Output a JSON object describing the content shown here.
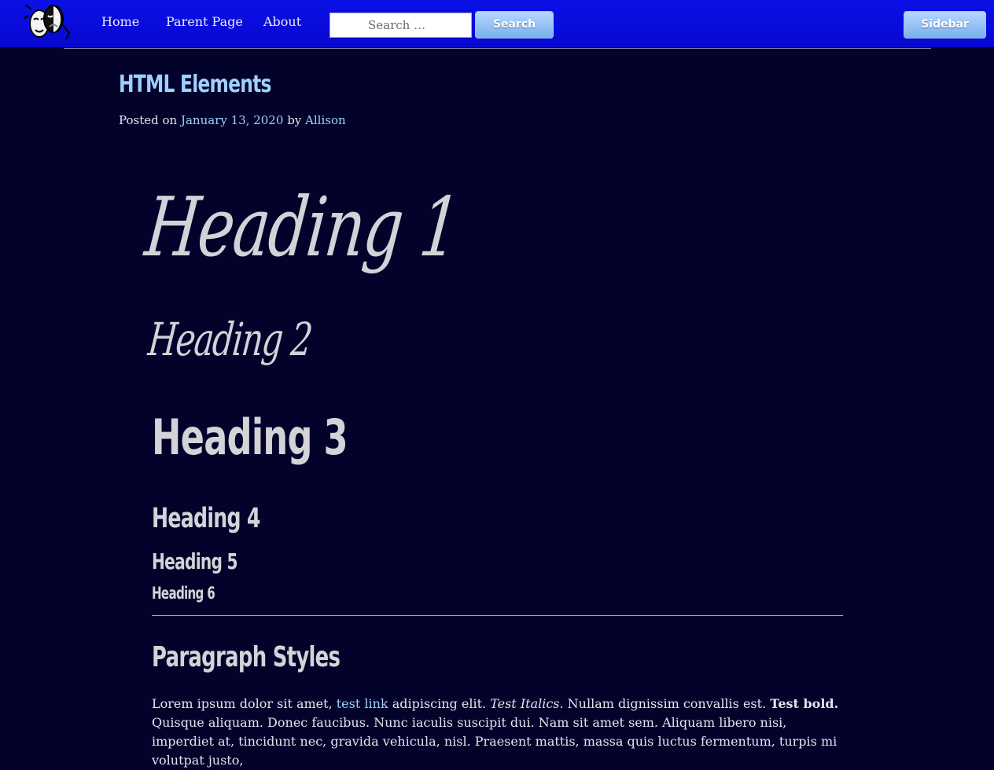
{
  "nav": {
    "logo_icon": "theater-masks-icon",
    "items": [
      "Home",
      "Parent Page",
      "About"
    ]
  },
  "search": {
    "placeholder": "Search …",
    "button_label": "Search"
  },
  "sidebar_button": "Sidebar",
  "post": {
    "title": "HTML Elements",
    "posted_on": "Posted on",
    "date": "January 13, 2020",
    "by": "by",
    "author": "Allison"
  },
  "headings": {
    "h1": "Heading 1",
    "h2": "Heading 2",
    "h3": "Heading 3",
    "h4": "Heading 4",
    "h5": "Heading 5",
    "h6": "Heading 6"
  },
  "paragraph_section": {
    "title": "Paragraph Styles",
    "text_1": "Lorem ipsum dolor sit amet, ",
    "link": "test link",
    "text_2": " adipiscing elit. ",
    "italic": "Test Italics.",
    "text_3": " Nullam dignissim convallis est. ",
    "bold": "Test bold.",
    "text_4": " Quisque aliquam. Donec faucibus. Nunc iaculis suscipit dui. Nam sit amet sem. Aliquam libero nisi, imperdiet at, tincidunt nec, gravida vehicula, nisl. Praesent mattis, massa quis luctus fermentum, turpis mi volutpat justo,"
  },
  "colors": {
    "topbar": "#0a10e6",
    "background": "#02022a",
    "link": "#9fd0ff",
    "heading": "#d3d3d8",
    "button": "#79b0ec"
  }
}
